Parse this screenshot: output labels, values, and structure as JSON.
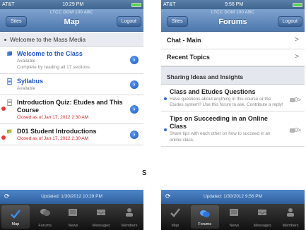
{
  "left_phone": {
    "status": {
      "carrier": "AT&T",
      "time": "10:29 PM"
    },
    "nav": {
      "subtitle": "LTCC DOM 100 ABC",
      "title": "Map",
      "left_button": "Sites",
      "right_button": "Logout"
    },
    "welcome": "Welcome to the Mass Media",
    "rows": [
      {
        "title": "Welcome to the Class",
        "lines": [
          "Available",
          "Complete by reading all 17 sections"
        ],
        "blue": true,
        "red": false,
        "icon": "module-icon"
      },
      {
        "title": "Syllabus",
        "lines": [
          "Available"
        ],
        "blue": true,
        "red": false,
        "icon": "document-icon"
      },
      {
        "title": "Introduction Quiz: Etudes and This Course",
        "lines": [
          "Closed as of Jan 17, 2012 2:30 AM"
        ],
        "blue": false,
        "red": true,
        "icon": "quiz-icon"
      },
      {
        "title": "D01 Student Introductions",
        "lines": [
          "Closed as of Jan 17, 2012 2:30 AM"
        ],
        "blue": false,
        "red": true,
        "icon": "discussion-icon"
      }
    ],
    "updated": "Updated: 1/30/2012 10:29 PM"
  },
  "right_phone": {
    "status": {
      "carrier": "AT&T",
      "time": "9:56 PM"
    },
    "nav": {
      "subtitle": "LTCC DOM 100 ABC",
      "title": "Forums",
      "left_button": "Sites",
      "right_button": "Logout"
    },
    "top_rows": [
      "Chat - Main",
      "Recent Topics"
    ],
    "section": "Sharing Ideas and Insights",
    "topics": [
      {
        "title": "Class and Etudes Questions",
        "desc": "Have questions about anything in this course or the Etudes system? Use this forum to ask. Contribute a reply!",
        "count": "0"
      },
      {
        "title": "Tips on Succeeding in an Online Class",
        "desc": "Share tips with each other on how to succeed in an online class.",
        "count": "0"
      }
    ],
    "updated": "Updated: 1/30/2012 9:56 PM"
  },
  "tabs": [
    "Map",
    "Forums",
    "News",
    "Messages",
    "Members"
  ],
  "callout_text": "s",
  "colors": {
    "nav": "#4d78ad",
    "link_blue": "#1f56c9",
    "closed_red": "#d62020",
    "tabbar": "#111111"
  }
}
